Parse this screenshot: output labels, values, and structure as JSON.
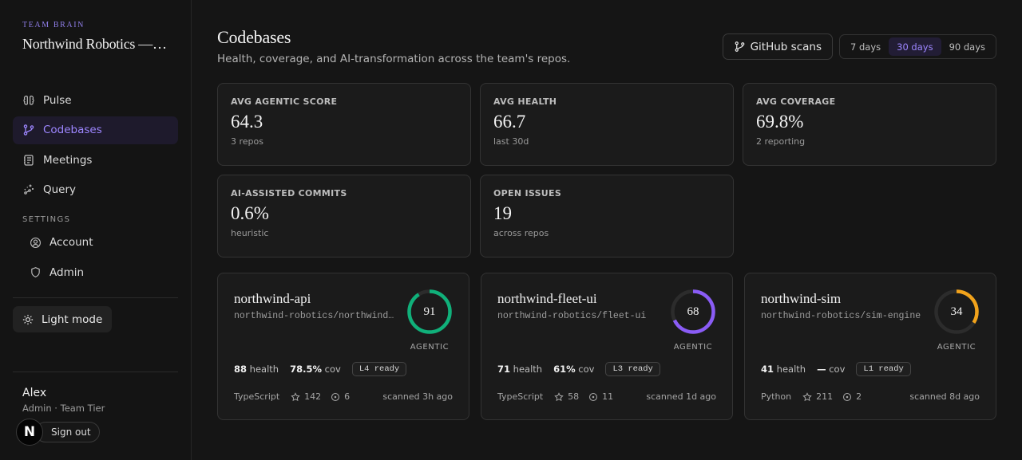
{
  "sidebar": {
    "kicker": "TEAM BRAIN",
    "team_title": "Northwind Robotics — AI Tr...",
    "nav": [
      {
        "label": "Pulse",
        "icon": "pulse-icon"
      },
      {
        "label": "Codebases",
        "icon": "branch-icon",
        "active": true
      },
      {
        "label": "Meetings",
        "icon": "notebook-icon"
      },
      {
        "label": "Query",
        "icon": "sparkle-icon"
      }
    ],
    "settings_label": "SETTINGS",
    "settings": [
      {
        "label": "Account",
        "icon": "user-circle-icon"
      },
      {
        "label": "Admin",
        "icon": "shield-icon"
      }
    ],
    "mode_label": "Light mode",
    "user": {
      "name": "Alex",
      "role": "Admin · Team Tier",
      "avatar_letter": "N",
      "signout": "Sign out"
    }
  },
  "header": {
    "title": "Codebases",
    "subtitle": "Health, coverage, and AI-transformation across the team's repos.",
    "github_label": "GitHub scans",
    "ranges": [
      "7 days",
      "30 days",
      "90 days"
    ],
    "active_range": "30 days"
  },
  "stats": [
    {
      "label": "AVG AGENTIC SCORE",
      "value": "64.3",
      "note": "3 repos"
    },
    {
      "label": "AVG HEALTH",
      "value": "66.7",
      "note": "last 30d"
    },
    {
      "label": "AVG COVERAGE",
      "value": "69.8%",
      "note": "2 reporting"
    },
    {
      "label": "AI-ASSISTED COMMITS",
      "value": "0.6%",
      "note": "heuristic"
    },
    {
      "label": "OPEN ISSUES",
      "value": "19",
      "note": "across repos"
    }
  ],
  "repos": [
    {
      "name": "northwind-api",
      "path": "northwind-robotics/northwind-api",
      "score": "91",
      "score_fraction": 0.91,
      "ring_color": "#10b07a",
      "score_label": "AGENTIC",
      "health": "88",
      "health_unit": "health",
      "cov": "78.5%",
      "cov_unit": "cov",
      "badge": "L4 ready",
      "lang": "TypeScript",
      "stars": "142",
      "issues": "6",
      "scanned": "scanned 3h ago"
    },
    {
      "name": "northwind-fleet-ui",
      "path": "northwind-robotics/fleet-ui",
      "score": "68",
      "score_fraction": 0.68,
      "ring_color": "#8a5cf6",
      "score_label": "AGENTIC",
      "health": "71",
      "health_unit": "health",
      "cov": "61%",
      "cov_unit": "cov",
      "badge": "L3 ready",
      "lang": "TypeScript",
      "stars": "58",
      "issues": "11",
      "scanned": "scanned 1d ago"
    },
    {
      "name": "northwind-sim",
      "path": "northwind-robotics/sim-engine",
      "score": "34",
      "score_fraction": 0.34,
      "ring_color": "#f2a31b",
      "score_label": "AGENTIC",
      "health": "41",
      "health_unit": "health",
      "cov": "—",
      "cov_unit": "cov",
      "badge": "L1 ready",
      "lang": "Python",
      "stars": "211",
      "issues": "2",
      "scanned": "scanned 8d ago"
    }
  ]
}
